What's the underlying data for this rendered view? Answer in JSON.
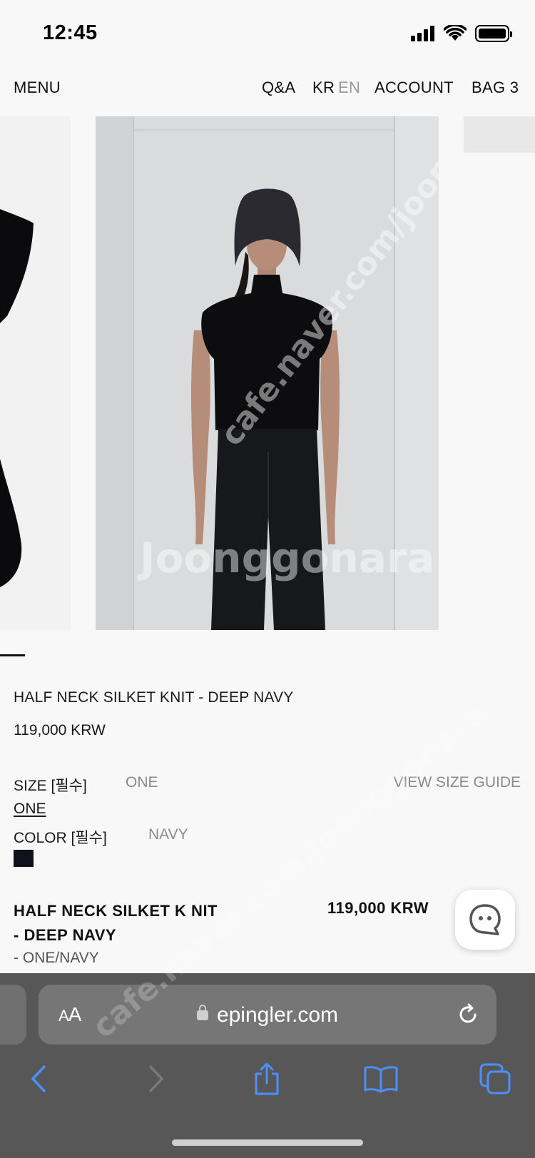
{
  "status_bar": {
    "time": "12:45"
  },
  "header": {
    "menu": "MENU",
    "qa": "Q&A",
    "lang_kr": "KR",
    "lang_en": "EN",
    "account": "ACCOUNT",
    "bag": "BAG 3"
  },
  "product": {
    "title": "HALF NECK SILKET KNIT - DEEP NAVY",
    "price": "119,000 KRW",
    "size_label": "SIZE [필수]",
    "size_value": "ONE",
    "size_guide": "VIEW SIZE GUIDE",
    "size_option": "ONE",
    "color_label": "COLOR [필수]",
    "color_value": "NAVY",
    "swatch_color": "#0f1218"
  },
  "selection": {
    "name": "HALF NECK SILKET K NIT - DEEP NAVY",
    "price": "119,000 KRW",
    "option": "- ONE/NAVY"
  },
  "browser": {
    "text_size": "AA",
    "url": "epingler.com"
  },
  "watermarks": {
    "brand": "Joonggonara",
    "url": "cafe.naver.com/joonggonara"
  },
  "icons": {
    "back": "chevron-left-icon",
    "forward": "chevron-right-icon",
    "share": "share-icon",
    "bookmarks": "book-icon",
    "tabs": "tabs-icon",
    "chat": "chat-bubble-icon"
  }
}
